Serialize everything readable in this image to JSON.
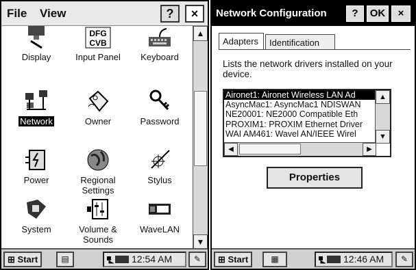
{
  "left": {
    "menu": {
      "file": "File",
      "view": "View"
    },
    "header_buttons": {
      "help": "?",
      "close": "×"
    },
    "icons": [
      {
        "label": "Display",
        "icon": "display-icon"
      },
      {
        "label": "Input Panel",
        "icon": "input-panel-icon",
        "glyph_top": "DFG",
        "glyph_bottom": "CVB"
      },
      {
        "label": "Keyboard",
        "icon": "keyboard-icon"
      },
      {
        "label": "Network",
        "icon": "network-icon",
        "selected": true
      },
      {
        "label": "Owner",
        "icon": "owner-icon"
      },
      {
        "label": "Password",
        "icon": "password-icon"
      },
      {
        "label": "Power",
        "icon": "power-icon"
      },
      {
        "label": "Regional Settings",
        "icon": "regional-settings-icon"
      },
      {
        "label": "Stylus",
        "icon": "stylus-icon"
      },
      {
        "label": "System",
        "icon": "system-icon"
      },
      {
        "label": "Volume & Sounds",
        "icon": "volume-sounds-icon"
      },
      {
        "label": "WaveLAN",
        "icon": "wavelan-icon"
      }
    ],
    "taskbar": {
      "start": "Start",
      "clock": "12:54 AM"
    }
  },
  "right": {
    "title": "Network Configuration",
    "header_buttons": {
      "help": "?",
      "ok": "OK",
      "close": "×"
    },
    "tabs": [
      {
        "label": "Adapters",
        "active": true
      },
      {
        "label": "Identification",
        "active": false
      }
    ],
    "description": "Lists the network drivers installed on your device.",
    "adapters": [
      "Aironet1: Aironet Wireless LAN Ad",
      "AsyncMac1: AsyncMac1 NDISWAN",
      "NE20001: NE2000 Compatible Eth",
      "PROXIM1: PROXIM Ethernet Driver",
      "WAI AM461: Wavel AN/IEEE Wirel"
    ],
    "selected_adapter": 0,
    "properties_button": "Properties",
    "taskbar": {
      "start": "Start",
      "clock": "12:46 AM"
    }
  },
  "colors": {
    "selection": "#000000",
    "chrome": "#d8d8d8",
    "background": "#ffffff"
  }
}
